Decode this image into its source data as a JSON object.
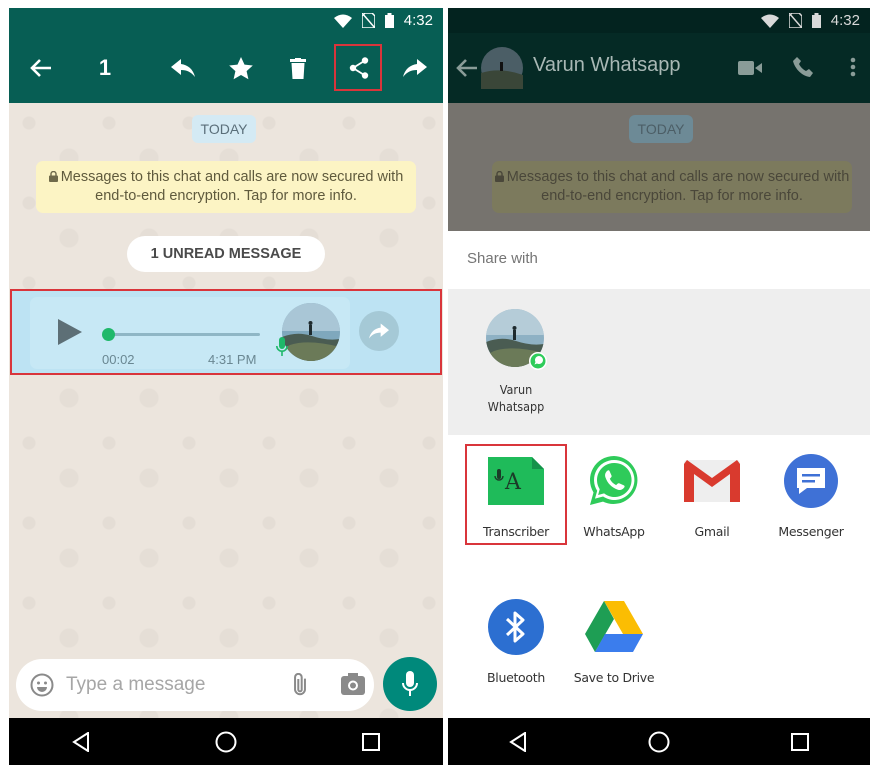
{
  "status_bar": {
    "time": "4:32"
  },
  "selection_toolbar": {
    "count": "1",
    "actions": [
      "reply",
      "star",
      "delete",
      "share",
      "forward"
    ]
  },
  "chat": {
    "date_label": "TODAY",
    "encryption_notice": "Messages to this chat and calls are now secured with end-to-end encryption. Tap for more info.",
    "unread_label": "1 UNREAD MESSAGE",
    "voice_message": {
      "duration": "00:02",
      "time": "4:31 PM",
      "progress": 0.0
    }
  },
  "input_bar": {
    "placeholder": "Type a message"
  },
  "right_header": {
    "contact_name": "Varun Whatsapp"
  },
  "share_sheet": {
    "title": "Share with",
    "direct_share": {
      "name_line1": "Varun",
      "name_line2": "Whatsapp"
    },
    "apps": [
      {
        "label": "Transcriber"
      },
      {
        "label": "WhatsApp"
      },
      {
        "label": "Gmail"
      },
      {
        "label": "Messenger"
      },
      {
        "label": "Bluetooth"
      },
      {
        "label": "Save to Drive"
      }
    ]
  },
  "colors": {
    "whatsapp_teal": "#075e54",
    "highlight_red": "#d9353b",
    "mic_fab": "#00897b",
    "transcriber_green": "#1fbb5a",
    "bluetooth_blue": "#2c6fd1",
    "messenger_blue": "#3f71d6",
    "gmail_red": "#d93a2e"
  }
}
